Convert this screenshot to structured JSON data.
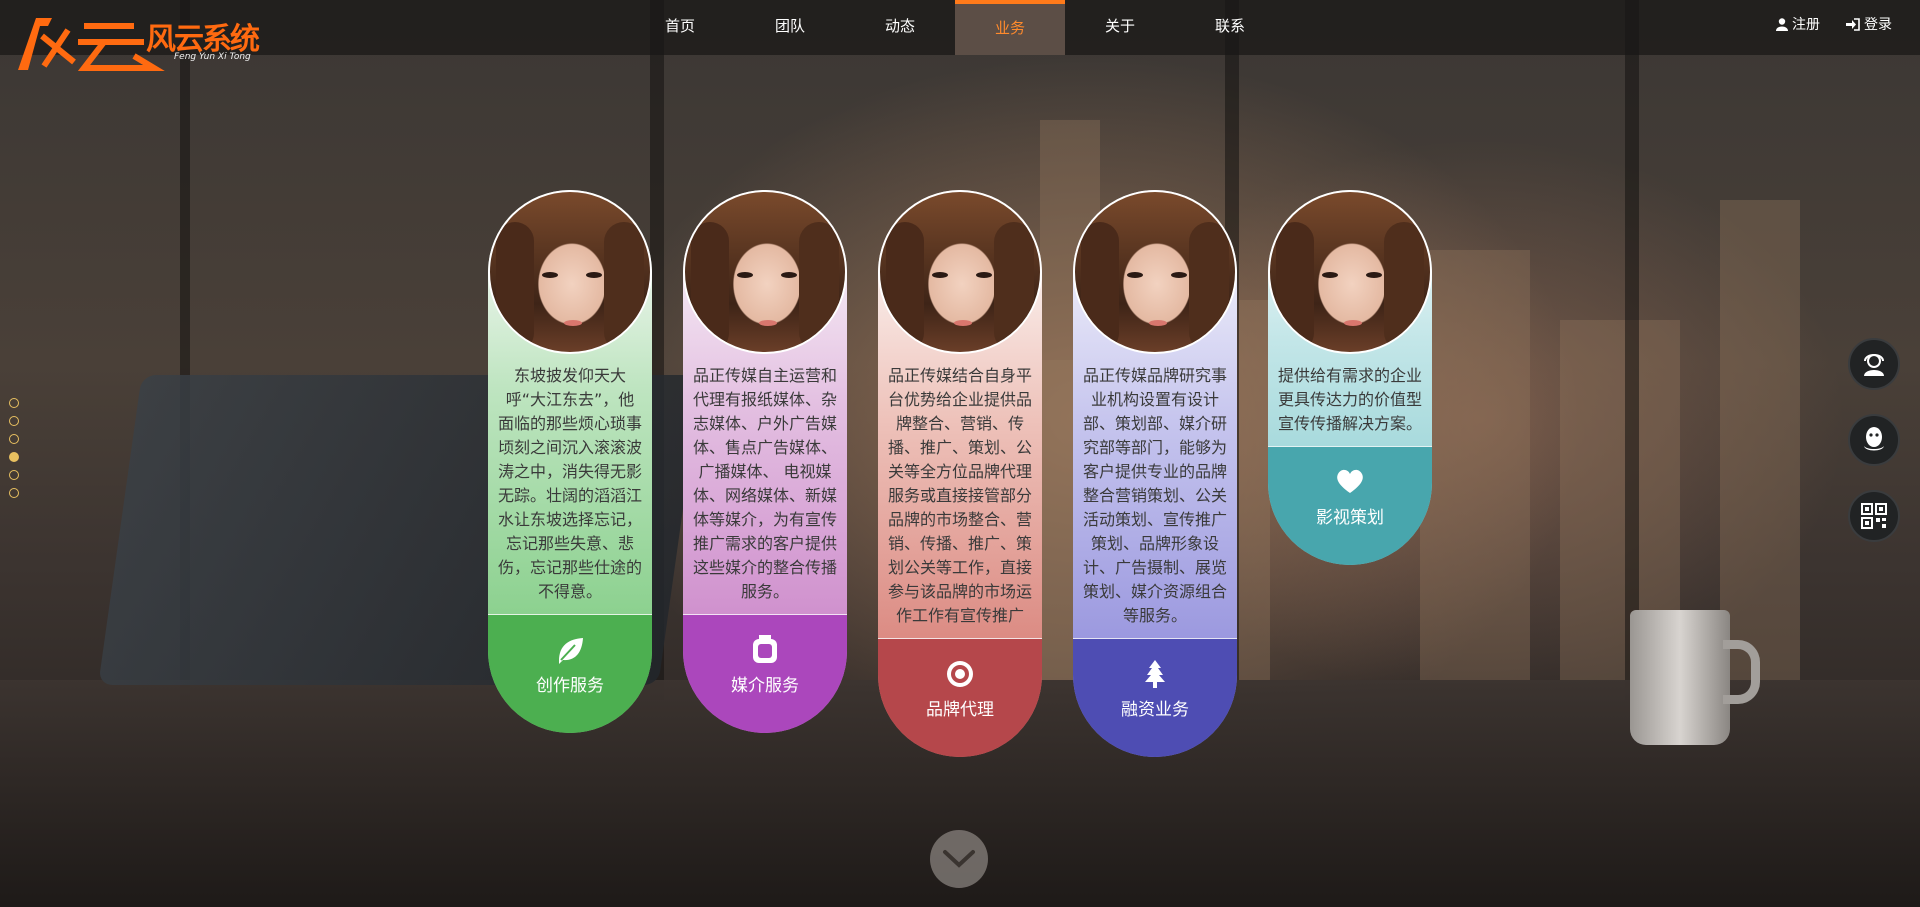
{
  "brand": {
    "logo_text": "风云系统",
    "logo_subtitle": "Feng Yun Xi Tong",
    "accent": "#ff7a1a"
  },
  "nav": {
    "items": [
      {
        "label": "首页",
        "active": false
      },
      {
        "label": "团队",
        "active": false
      },
      {
        "label": "动态",
        "active": false
      },
      {
        "label": "业务",
        "active": true
      },
      {
        "label": "关于",
        "active": false
      },
      {
        "label": "联系",
        "active": false
      }
    ]
  },
  "auth": {
    "register_label": "注册",
    "login_label": "登录"
  },
  "side_buttons": [
    "customer-service-icon",
    "qq-icon",
    "qrcode-icon"
  ],
  "cards": [
    {
      "text": "东坡披发仰天大呼“大江东去”，他面临的那些烦心琐事顷刻之间沉入滚滚波涛之中，消失得无影无踪。壮阔的滔滔江水让东坡选择忘记，忘记那些失意、悲伤，忘记那些仕途的不得意。",
      "icon": "leaf-icon",
      "label": "创作服务",
      "color": "#4caf50"
    },
    {
      "text": "品正传媒自主运营和代理有报纸媒体、杂志媒体、户外广告媒体、售点广告媒体、 广播媒体、 电视媒体、网络媒体、新媒体等媒介，为有宣传推广需求的客户提供这些媒介的整合传播服务。",
      "icon": "square-icon",
      "label": "媒介服务",
      "color": "#ab47bc"
    },
    {
      "text": "品正传媒结合自身平台优势给企业提供品牌整合、营销、传播、推广、策划、公关等全方位品牌代理服务或直接接管部分品牌的市场整合、营销、传播、推广、策划公关等工作，直接参与该品牌的市场运作工作有宣传推广",
      "icon": "target-icon",
      "label": "品牌代理",
      "color": "#b5474b"
    },
    {
      "text": "品正传媒品牌研究事业机构设置有设计部、策划部、媒介研究部等部门，能够为客户提供专业的品牌整合营销策划、公关活动策划、宣传推广策划、品牌形象设计、广告摄制、展览策划、媒介资源组合等服务。",
      "icon": "tree-icon",
      "label": "融资业务",
      "color": "#4e4db3"
    },
    {
      "text": "提供给有需求的企业更具传达力的价值型宣传传播解决方案。",
      "icon": "heart-icon",
      "label": "影视策划",
      "color": "#48a6ad"
    }
  ],
  "pager": {
    "count": 6,
    "active_index": 3
  },
  "scroll_down": {
    "icon": "chevron-down-icon"
  }
}
